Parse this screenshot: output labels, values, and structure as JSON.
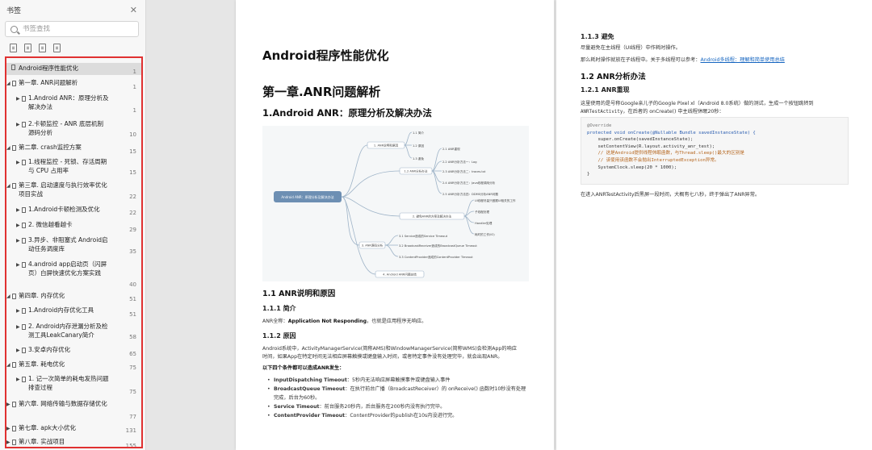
{
  "sidebar": {
    "title": "书签",
    "search_placeholder": "书签查找",
    "toc": [
      {
        "label": "Android程序性能优化",
        "page": "1"
      },
      {
        "label": "第一章. ANR问题解析",
        "page": "1"
      },
      {
        "label": "1.Android ANR：原理分析及解决办法",
        "page": "1"
      },
      {
        "label": "2.卡顿监控 - ANR 底层机制源码分析",
        "page": "10"
      },
      {
        "label": "第二章. crash监控方案",
        "page": "15"
      },
      {
        "label": "1.线程监控 - 死锁、存活周期与 CPU 占用率",
        "page": "15"
      },
      {
        "label": "第三章. 启动速度与执行效率优化项目实战",
        "page": "22"
      },
      {
        "label": "1.Android卡顿检测及优化",
        "page": "22"
      },
      {
        "label": "2. 微信越看越卡",
        "page": "29"
      },
      {
        "label": "3.异步、非阻塞式 Android启动任务调度库",
        "page": "35"
      },
      {
        "label": "4.android app启动页（闪屏页）白屏快速优化方案实践",
        "page": "40"
      },
      {
        "label": "第四章. 内存优化",
        "page": "51"
      },
      {
        "label": "1.Android内存优化工具",
        "page": "51"
      },
      {
        "label": "2. Android内存泄漏分析及检测工具LeakCanary简介",
        "page": "58"
      },
      {
        "label": "3.安卓内存优化",
        "page": "65"
      },
      {
        "label": "第五章. 耗电优化",
        "page": "75"
      },
      {
        "label": "1. 记一次简单的耗电发热问题排查过程",
        "page": "75"
      },
      {
        "label": "第六章. 网络传输与数据存储优化",
        "page": "77"
      },
      {
        "label": "第七章. apk大小优化",
        "page": "131"
      },
      {
        "label": "第八章. 实战项目",
        "page": "155"
      }
    ]
  },
  "page_left": {
    "title": "Android程序性能优化",
    "chapter": "第一章.ANR问题解析",
    "section": "1.Android ANR：原理分析及解决办法",
    "mindmap": {
      "root": "Android ANR：原理分析及解决办法",
      "branches": [
        "1. ANR说明和原因",
        "1.2 ANR分析办法",
        "2. 避免ANR的方案及解决办法",
        "3. ANR源码分析",
        "4. Android ANR问题总结"
      ],
      "leaves_top": [
        "1.1 简介",
        "1.2 原因",
        "1.3 避免"
      ],
      "leaves_mid": [
        "2.1 ANR重现",
        "2.2 ANR分析方法一：Log",
        "2.3 ANR分析方法二：traces.txt",
        "2.4 ANR分析方法三：Java线程调用分析",
        "2.5 ANR分析方法四：DDMS分析ANR问题"
      ],
      "leaves_avoid": [
        "UI线程尽量只做跟UI相关的工作",
        "子线程处理",
        "Handler处理",
        "耗时的工作(IO)"
      ],
      "leaves_src": [
        "3.1 Service造成的Service Timeout",
        "3.2 BroadcastReceiver造成的BroadcastQueue Timeout",
        "3.3 ContentProvider造成的ContentProvider Timeout"
      ]
    },
    "h_11": "1.1 ANR说明和原因",
    "h_111": "1.1.1 简介",
    "p_111_a": "ANR全称：",
    "p_111_b": "Application Not Responding",
    "p_111_c": "，也就是应用程序无响应。",
    "h_112": "1.1.2 原因",
    "p_112_l1": "Android系统中，ActivityManagerService(简称AMS)和WindowManagerService(简称WMS)会检测App的响应",
    "p_112_l2": "时间，如果App在特定时间无法相应屏幕触摸或键盘输入时间，或者特定事件没有处理完毕，就会出现ANR。",
    "p_conditions": "以下四个条件都可以造成ANR发生：",
    "bullets": [
      {
        "name": "InputDispatching Timeout",
        "text": "：5秒内无法响应屏幕触摸事件或键盘输入事件"
      },
      {
        "name": "BroadcastQueue Timeout",
        "text": "：在执行前台广播（BroadcastReceiver）的 onReceive() 函数时10秒没有处理"
      },
      {
        "name": "",
        "text": "完成，后台为60秒。"
      },
      {
        "name": "Service Timeout",
        "text": "：前台服务20秒内，后台服务在200秒内没有执行完毕。"
      },
      {
        "name": "ContentProvider Timeout",
        "text": "：ContentProvider的publish在10s内没进行完。"
      }
    ]
  },
  "page_right": {
    "h_113": "1.1.3 避免",
    "p_113_1": "尽量避免在主线程（UI线程）中作耗时操作。",
    "p_113_2a": "那么耗时操作就放在子线程中。关于多线程可以参考：",
    "p_113_2b": "Android多线程：理解和简单使用总结",
    "h_12": "1.2 ANR分析办法",
    "h_121": "1.2.1 ANR重现",
    "p_121_l1": "这里使用的是号称Google亲儿子的Google Pixel xl（Android 8.0系统）做的测试，生成一个按钮跳转到",
    "p_121_l2a": "ANRTestActivity",
    "p_121_l2b": "，在后者的 onCreate() 中主线程休眠20秒：",
    "code": [
      "@Override",
      "protected void onCreate(@Nullable Bundle savedInstanceState) {",
      "    super.onCreate(savedInstanceState);",
      "    setContentView(R.layout.activity_anr_test);",
      "    // 这是Android提供线程休眠函数，与Thread.sleep()最大的区别是",
      "    // 该使用该函数不会抛出InterruptedException异常。",
      "    SystemClock.sleep(20 * 1000);",
      "}"
    ],
    "p_after": "在进入ANRTestActivity后黑屏一段时间，大概有七八秒，终于弹出了ANR异常。"
  },
  "colors": {
    "highlight_border": "#e03131",
    "link": "#1565c0",
    "mindmap_root": "#6d8fb3"
  }
}
